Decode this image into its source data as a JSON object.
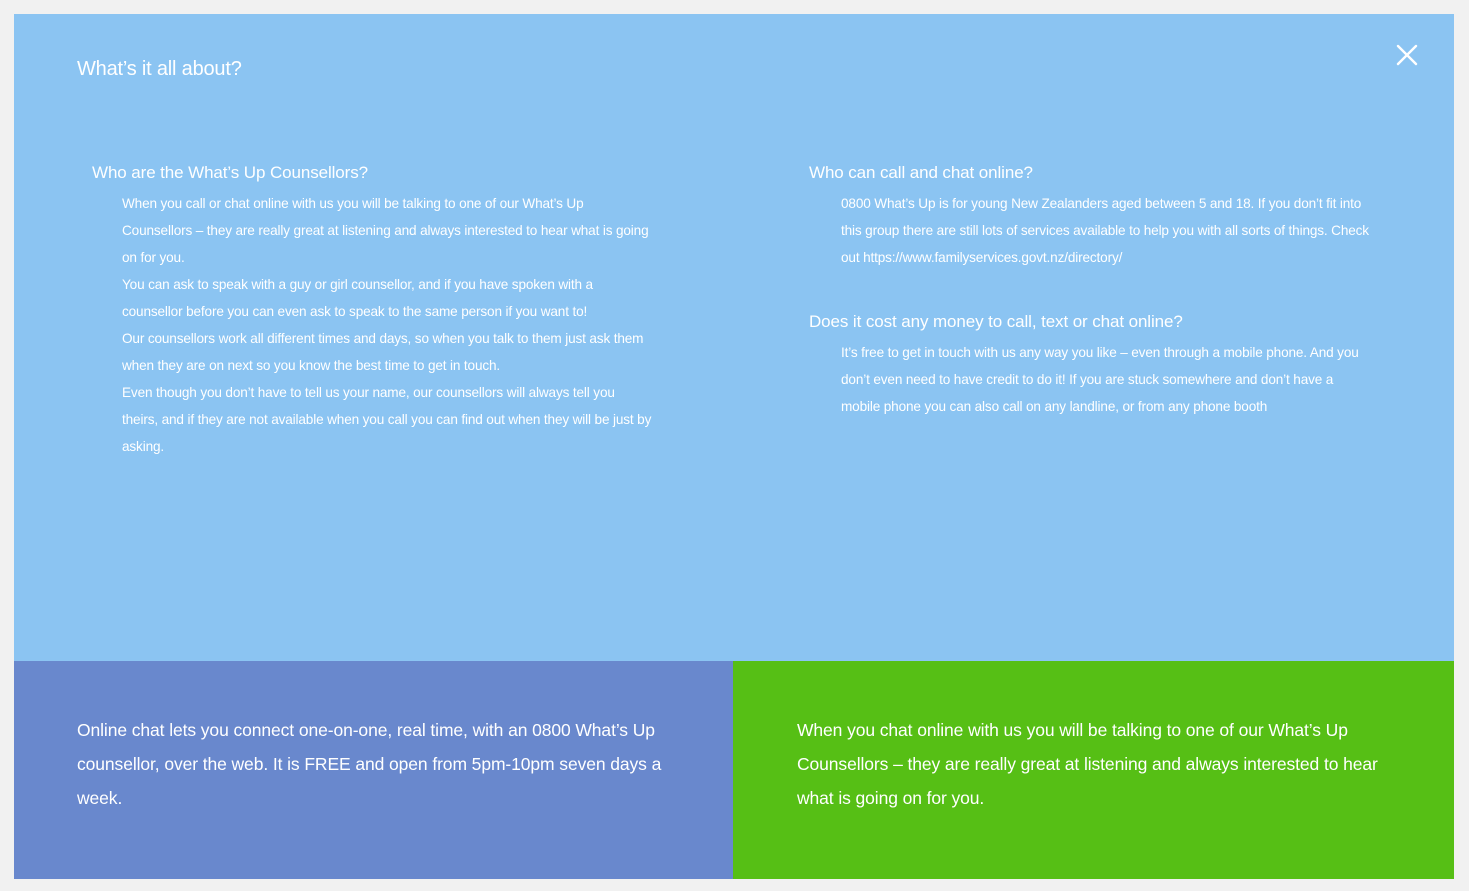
{
  "modal": {
    "title": "What’s it all about?",
    "close_icon": "close-icon"
  },
  "left_column": {
    "heading": "Who are the What’s Up Counsellors?",
    "paragraphs": [
      "When you call or chat online with us you will be talking to one of our What’s Up Counsellors – they are really great at listening and always interested to hear what is going on for you.",
      "You can ask to speak with a guy or girl counsellor, and if you have spoken with a counsellor before you can even ask to speak to the same person if you want to!",
      "Our counsellors work all different times and days, so when you talk to them just ask them when they are on next so you know the best time to get in touch.",
      "Even though you don’t have to tell us your name, our counsellors will always tell you theirs, and if they are not available when you call you can find out when they will be just by asking."
    ]
  },
  "right_column": {
    "blocks": [
      {
        "heading": "Who can call and chat online?",
        "body": "0800 What’s Up is for young New Zealanders aged between 5 and 18.  If you don’t fit into this group there are still lots of services available to help you with all sorts of things. Check out https://www.familyservices.govt.nz/directory/"
      },
      {
        "heading": "Does it cost any money to call, text or chat online?",
        "body": "It’s free to get in touch with us any way you like – even through a mobile phone. And you don’t even need to have credit to do it!  If you are stuck somewhere and don’t have a mobile phone you can also call on any landline, or from any phone booth"
      }
    ]
  },
  "bottom": {
    "left_text": "Online chat lets you connect one-on-one, real time, with an 0800 What’s Up counsellor, over the web. It is FREE and open from 5pm-10pm seven days a week.",
    "right_text": "When you chat online with us you will be talking to one of our What’s Up Counsellors – they are really great at listening and always interested to hear what is going on for you."
  },
  "colors": {
    "top_panel": "#8bc4f2",
    "bottom_left_panel": "#6988cd",
    "bottom_right_panel": "#56bf15",
    "text": "#ffffff"
  }
}
